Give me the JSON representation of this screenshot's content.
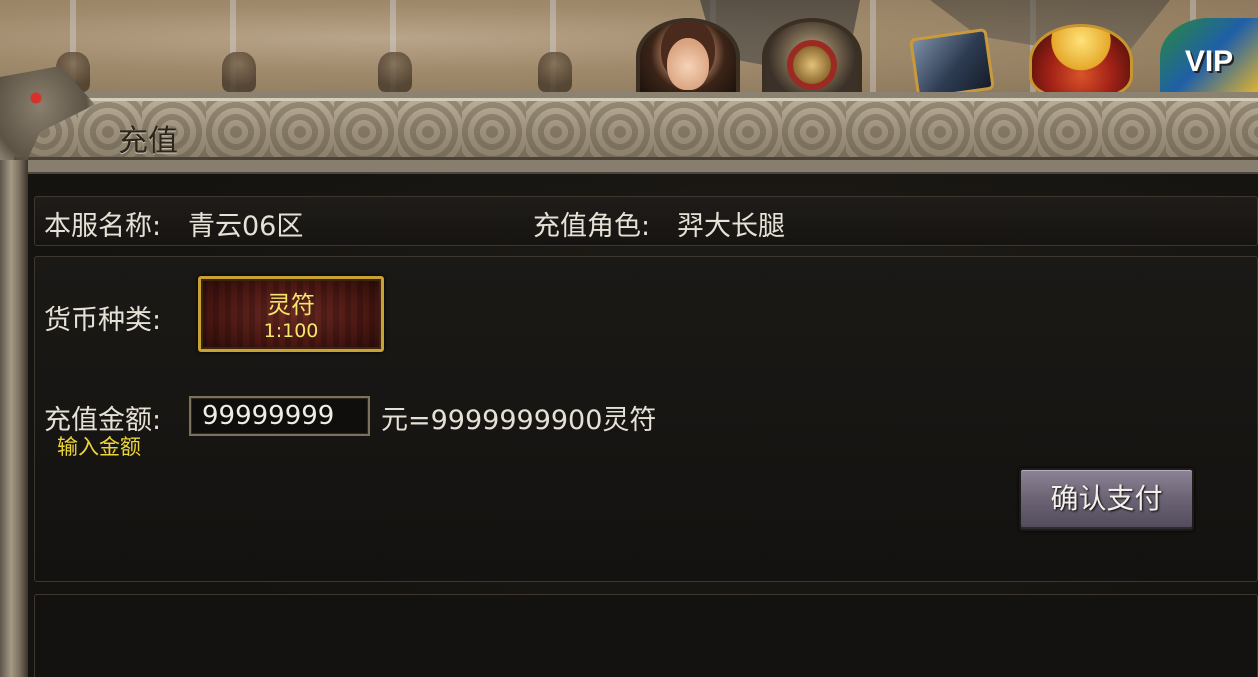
{
  "window": {
    "title": "充值"
  },
  "top_icons": [
    {
      "name": "customer-service-icon"
    },
    {
      "name": "shield-icon"
    },
    {
      "name": "treasure-box-icon"
    },
    {
      "name": "gold-pot-icon"
    },
    {
      "name": "vip-icon",
      "text": "VIP"
    }
  ],
  "info": {
    "server_label": "本服名称:",
    "server_value": "青云06区",
    "role_label": "充值角色:",
    "role_value": "羿大长腿"
  },
  "currency": {
    "label": "货币种类:",
    "option_name": "灵符",
    "option_rate": "1:100"
  },
  "amount": {
    "label": "充值金额:",
    "value": "99999999",
    "hint": "输入金额",
    "result_text": "元=9999999900灵符"
  },
  "actions": {
    "confirm_label": "确认支付"
  },
  "colors": {
    "accent_yellow": "#f4e66a",
    "hint_yellow": "#ecd53a",
    "gold_border": "#c9a233",
    "panel_dark": "#151310"
  }
}
